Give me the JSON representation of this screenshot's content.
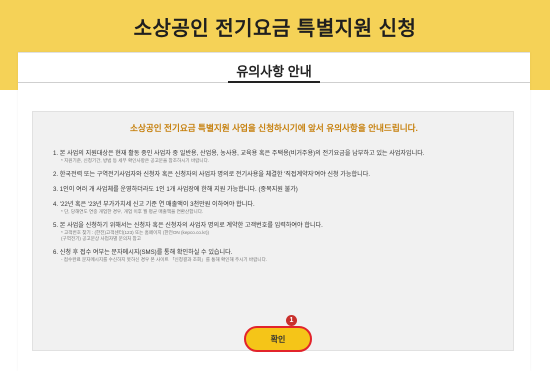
{
  "page": {
    "title": "소상공인 전기요금 특별지원 신청"
  },
  "section": {
    "title": "유의사항 안내"
  },
  "notice": {
    "intro": "소상공인 전기요금 특별지원 사업을 신청하시기에 앞서 유의사항을 안내드립니다.",
    "items": [
      {
        "text": "1. 본 사업의 지원대상은 현재 활동 중인 사업자 중 일반용, 산업용, 농사용, 교육용 혹은 주택용(비거주용)의 전기요금을 납부하고 있는 사업자입니다.",
        "subs": [
          "* 지원기준, 신청기간, 방법 등 세부 확인사항은 공고문을 참조하시기 바랍니다."
        ]
      },
      {
        "text": "2. 한국전력 또는 구역전기사업자와 신청자 혹은 신청자의 사업자 명의로 전기사용을 체결한 '직접계약자'여야 신청 가능합니다.",
        "subs": []
      },
      {
        "text": "3. 1인이 여러 개 사업체를 운영하더라도 1인 1개 사업장에 한해 지원 가능합니다. (중복지원 불가)",
        "subs": []
      },
      {
        "text": "4. '22년 혹은 '23년 부가가치세 신고 기준 연 매출액이 3천만원 이하여야 합니다.",
        "subs": [
          "* 단, 당해연도 연중 개업한 경우, 개업 이후 월 평균 매출액을 연환산합니다."
        ]
      },
      {
        "text": "5. 본 사업을 신청하기 위해서는 신청자 혹은 신청자의 사업자 명의로 계약한 고객번호를 입력하여야 합니다.",
        "subs": [
          "* 고객번호 찾기 : (한전)고객센터(123) 또는 홈페이지 (한전ON (kepco.co.kr))",
          "(구역전기) 공고문상 사업자별 문의처 참고"
        ]
      },
      {
        "text": "6. 신청 후 접수 여부는 문자메시지(SMS)를 통해 확인하실 수 있습니다.",
        "subs": [
          "- 접수완료 문자메시지를 수신하지 못하신 경우 본 사이트 「신청결과 조회」를 통해 확인해 주시기 바랍니다."
        ]
      }
    ]
  },
  "actions": {
    "confirm_label": "확인",
    "step_marker": "1"
  },
  "colors": {
    "header_band": "#f5d257",
    "intro_text": "#c6800d",
    "button_fill": "#f5c518",
    "button_outline": "#e2242b",
    "marker": "#c9302c"
  }
}
